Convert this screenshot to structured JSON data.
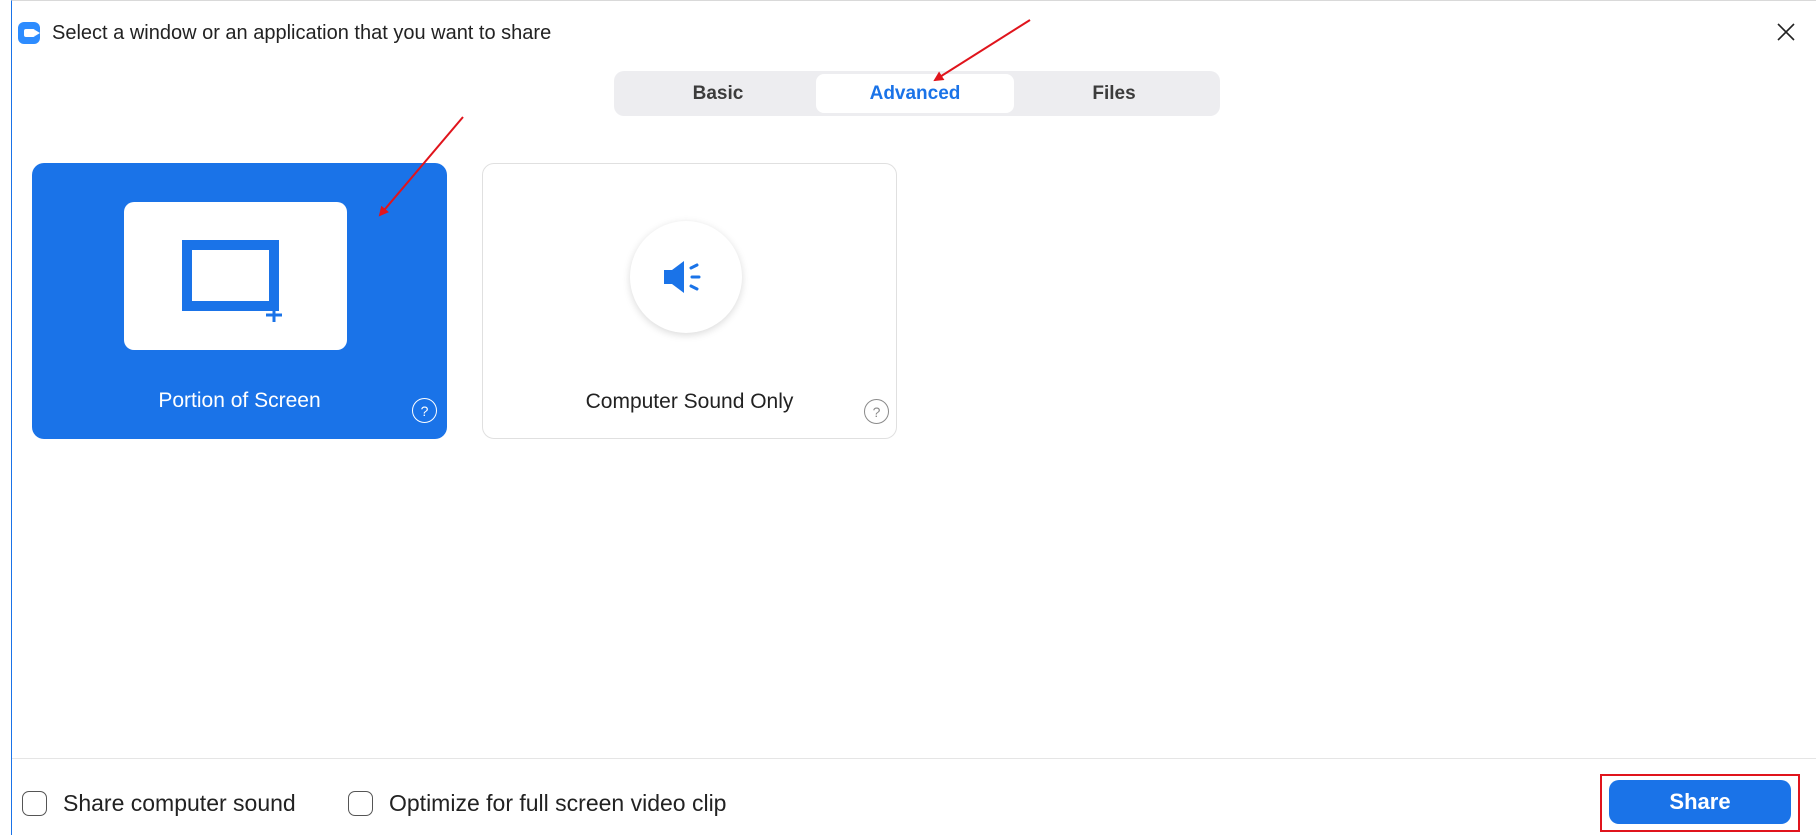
{
  "window": {
    "title": "Select a window or an application that you want to share",
    "close_label": "×"
  },
  "tabs": [
    {
      "label": "Basic",
      "active": false
    },
    {
      "label": "Advanced",
      "active": true
    },
    {
      "label": "Files",
      "active": false
    }
  ],
  "options": [
    {
      "label": "Portion of Screen",
      "icon": "screen-portion-icon",
      "selected": true,
      "help": "?"
    },
    {
      "label": "Computer Sound Only",
      "icon": "speaker-icon",
      "selected": false,
      "help": "?"
    }
  ],
  "footer": {
    "share_sound_label": "Share computer sound",
    "share_sound_checked": false,
    "optimize_label": "Optimize for full screen video clip",
    "optimize_checked": false,
    "share_button": "Share"
  },
  "colors": {
    "accent": "#1a73e8",
    "annotation_red": "#e0141c",
    "tab_bg": "#ededf0"
  }
}
